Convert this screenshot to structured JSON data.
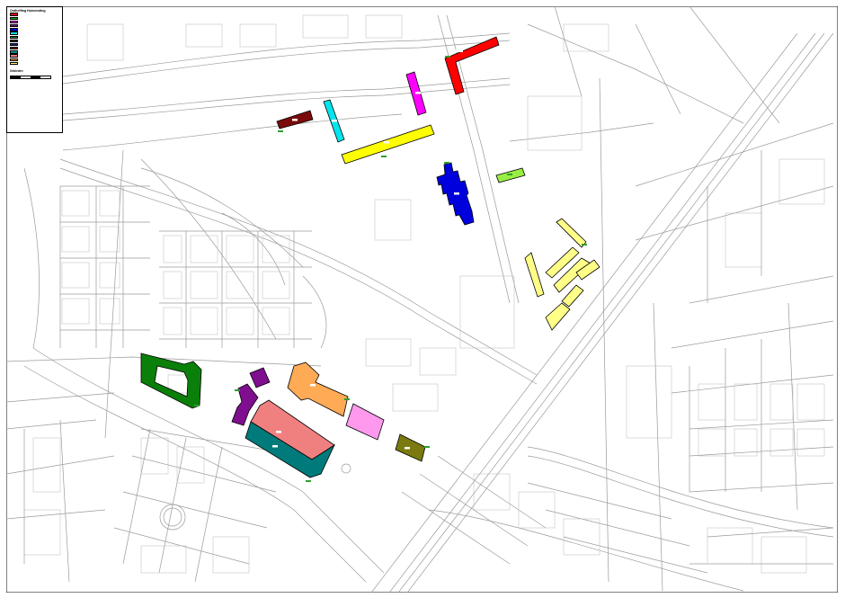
{
  "legend": {
    "title": "Ontheffing Huisvesting",
    "subtitle": "",
    "swatches": [
      {
        "color": "#e8001c"
      },
      {
        "color": "#00a000"
      },
      {
        "color": "#ff00ff"
      },
      {
        "color": "#800080"
      },
      {
        "color": "#0000cc"
      },
      {
        "color": "#00e0e0"
      },
      {
        "color": "#1b7f1b"
      },
      {
        "color": "#333300"
      },
      {
        "color": "#1a1a8a"
      },
      {
        "color": "#7f1010"
      },
      {
        "color": "#009090"
      },
      {
        "color": "#ff8080"
      },
      {
        "color": "#ffa040"
      },
      {
        "color": "#ffff80"
      }
    ],
    "section_title": "Gebieden",
    "notes": [
      "",
      "",
      ""
    ]
  },
  "map": {
    "blocks": [
      {
        "id": "red-block",
        "color": "#ff0000"
      },
      {
        "id": "magenta-block",
        "color": "#ff00ff"
      },
      {
        "id": "cyan-block",
        "color": "#00e5ee"
      },
      {
        "id": "darkred-block",
        "color": "#7b0b0b"
      },
      {
        "id": "yellow-block",
        "color": "#ffff00"
      },
      {
        "id": "blue-block",
        "color": "#0000dd"
      },
      {
        "id": "lightgreen-block",
        "color": "#99ee44"
      },
      {
        "id": "paleyellow-blocks",
        "color": "#ffff88"
      },
      {
        "id": "green-block",
        "color": "#0a7f0a"
      },
      {
        "id": "purple-block",
        "color": "#7f0f8f"
      },
      {
        "id": "orange-block",
        "color": "#ffaa55"
      },
      {
        "id": "pink-block",
        "color": "#ff99ee"
      },
      {
        "id": "olive-block",
        "color": "#7a7a10"
      },
      {
        "id": "salmon-block",
        "color": "#f08080"
      },
      {
        "id": "teal-block",
        "color": "#007a7a"
      }
    ]
  }
}
